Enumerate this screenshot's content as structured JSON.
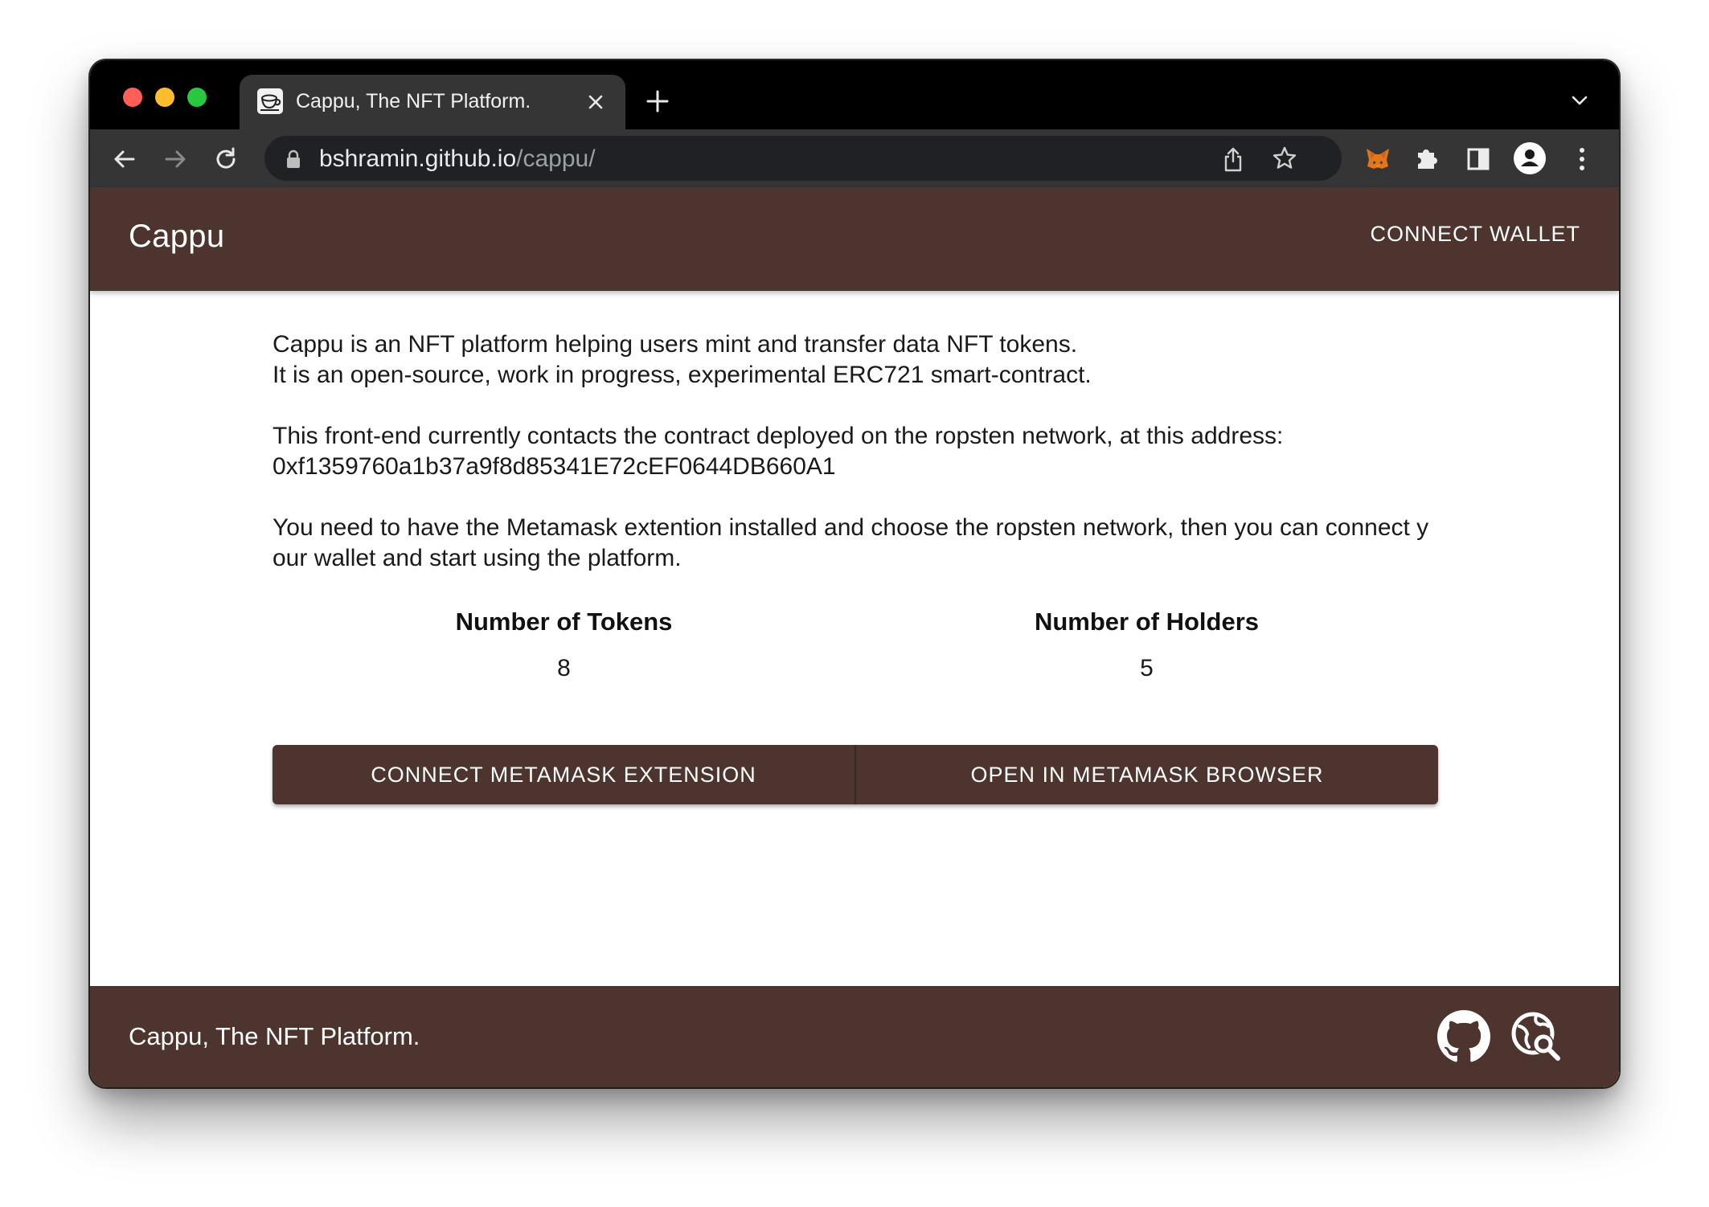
{
  "browser": {
    "tab_title": "Cappu, The NFT Platform.",
    "url_host": "bshramin.github.io",
    "url_path": "/cappu/"
  },
  "icons": {
    "tab_favicon": "cappu-favicon-icon",
    "tab_close": "close-icon",
    "new_tab": "plus-icon",
    "tab_list": "chevron-down-icon",
    "back": "arrow-left-icon",
    "forward": "arrow-right-icon",
    "reload": "reload-icon",
    "lock": "lock-icon",
    "share": "share-icon",
    "bookmark": "star-icon",
    "metamask": "metamask-fox-icon",
    "extensions": "puzzle-piece-icon",
    "side_panel": "side-panel-icon",
    "profile": "profile-avatar-icon",
    "menu": "kebab-menu-icon",
    "github": "github-icon",
    "etherscan": "globe-search-icon"
  },
  "app": {
    "brand": "Cappu",
    "connect_wallet": "CONNECT WALLET",
    "intro": {
      "line1": "Cappu is an NFT platform helping users mint and transfer data NFT tokens.",
      "line2": "It is an open-source, work in progress, experimental ERC721 smart-contract.",
      "line3": "This front-end currently contacts the contract deployed on the ropsten network, at this address:",
      "address": "0xf1359760a1b37a9f8d85341E72cEF0644DB660A1",
      "line4": "You need to have the Metamask extention installed and choose the ropsten network, then you can connect your wallet and start using the platform."
    },
    "stats": {
      "tokens_label": "Number of Tokens",
      "tokens_value": "8",
      "holders_label": "Number of Holders",
      "holders_value": "5"
    },
    "actions": {
      "connect_extension": "CONNECT METAMASK EXTENSION",
      "open_browser": "OPEN IN METAMASK BROWSER"
    },
    "footer_text": "Cappu, The NFT Platform."
  },
  "colors": {
    "brand_brown": "#4e342e",
    "tab_strip": "#000000",
    "toolbar": "#353535",
    "omnibox": "#202124"
  }
}
